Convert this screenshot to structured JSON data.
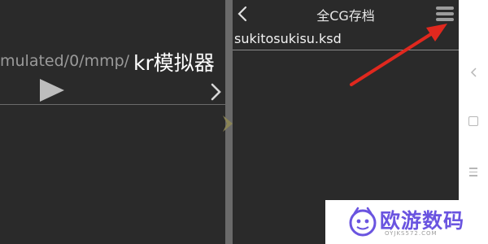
{
  "left_panel": {
    "path_prefix": "mulated/0/mmp/",
    "path_suffix": "kr模拟器"
  },
  "right_panel": {
    "title": "全CG存档",
    "files": [
      "sukitosukisu.ksd"
    ]
  },
  "watermark": {
    "text": "欧游数码",
    "url": "OYJKS572.COM"
  },
  "colors": {
    "background": "#2a2a2a",
    "divider": "#6a6a6a",
    "annotation_arrow": "#e0281e",
    "watermark_text": "#6a54e0"
  },
  "icons": {
    "left": [
      "play-icon",
      "chevron-right-icon"
    ],
    "right": [
      "back-icon",
      "menu-icon"
    ],
    "navbar": [
      "nav-back-icon",
      "nav-home-icon",
      "nav-menu-icon"
    ]
  }
}
